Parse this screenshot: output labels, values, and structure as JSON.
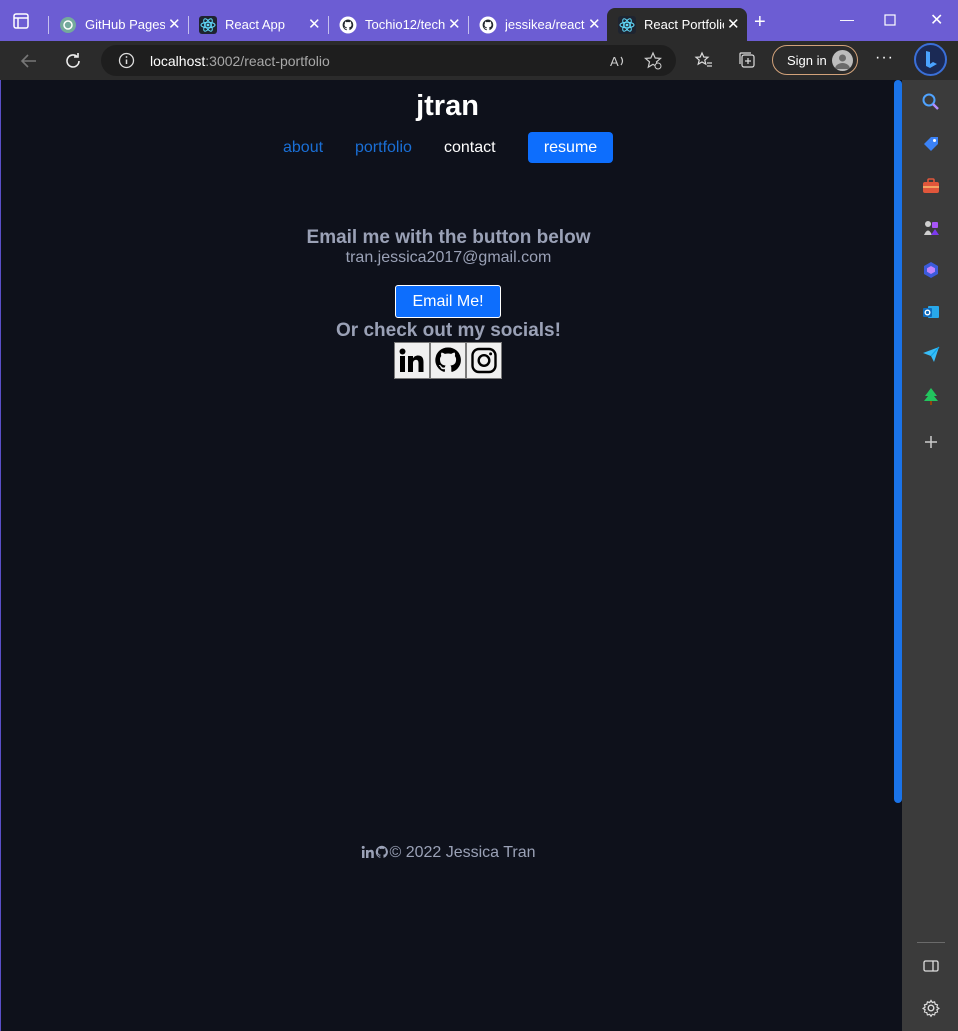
{
  "browser": {
    "tabs": [
      {
        "title": "GitHub Pages",
        "icon": "chatgpt-icon",
        "active": false
      },
      {
        "title": "React App",
        "icon": "react-icon",
        "active": false
      },
      {
        "title": "Tochio12/tech",
        "icon": "github-icon",
        "active": false
      },
      {
        "title": "jessikea/react",
        "icon": "github-icon",
        "active": false
      },
      {
        "title": "React Portfolio",
        "icon": "react-icon",
        "active": true
      }
    ],
    "address": {
      "host": "localhost",
      "path": ":3002/react-portfolio"
    },
    "sign_in_label": "Sign in",
    "accent_color": "#6c5dd3"
  },
  "site": {
    "logo": "jtran",
    "nav": {
      "about": "about",
      "portfolio": "portfolio",
      "contact": "contact",
      "resume": "resume"
    },
    "contact": {
      "heading": "Email me with the button below",
      "email": "tran.jessica2017@gmail.com",
      "button": "Email Me!",
      "socials_heading": "Or check out my socials!",
      "socials": [
        "linkedin-icon",
        "github-icon",
        "instagram-icon"
      ]
    },
    "footer": {
      "text": "© 2022 Jessica Tran"
    },
    "colors": {
      "background": "#0e111b",
      "link": "#1a6fd6",
      "primary": "#0d6efd",
      "muted_text": "#9aa1b6"
    }
  }
}
